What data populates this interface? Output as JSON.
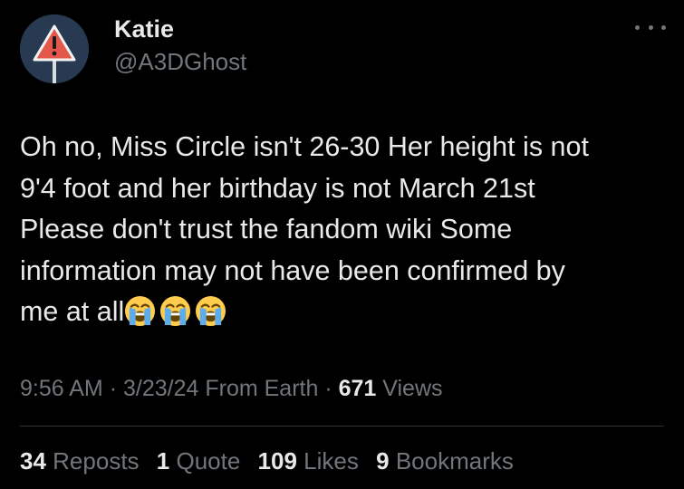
{
  "author": {
    "display_name": "Katie",
    "handle": "@A3DGhost",
    "avatar_icon": "warning-sign-icon"
  },
  "more_icon": "more-dots-icon",
  "tweet": {
    "lines": [
      "Oh no, Miss Circle isn't 26-30 Her height is not",
      "9'4 foot and her birthday is not March 21st",
      "Please don't trust the fandom wiki Some",
      "information may not have been confirmed by",
      "me at all"
    ],
    "emojis": [
      "loudly-crying-face-icon",
      "loudly-crying-face-icon",
      "loudly-crying-face-icon"
    ]
  },
  "meta": {
    "time": "9:56 AM",
    "separator": "·",
    "date": "3/23/24",
    "source": "From Earth",
    "views_count": "671",
    "views_label": "Views"
  },
  "stats": {
    "reposts": {
      "count": "34",
      "label": "Reposts"
    },
    "quotes": {
      "count": "1",
      "label": "Quote"
    },
    "likes": {
      "count": "109",
      "label": "Likes"
    },
    "bookmarks": {
      "count": "9",
      "label": "Bookmarks"
    }
  },
  "colors": {
    "background": "#000000",
    "primary_text": "#e7e9ea",
    "secondary_text": "#71767b",
    "divider": "#2f3336",
    "avatar_bg": "#273a52",
    "warning_red": "#e4574b"
  }
}
